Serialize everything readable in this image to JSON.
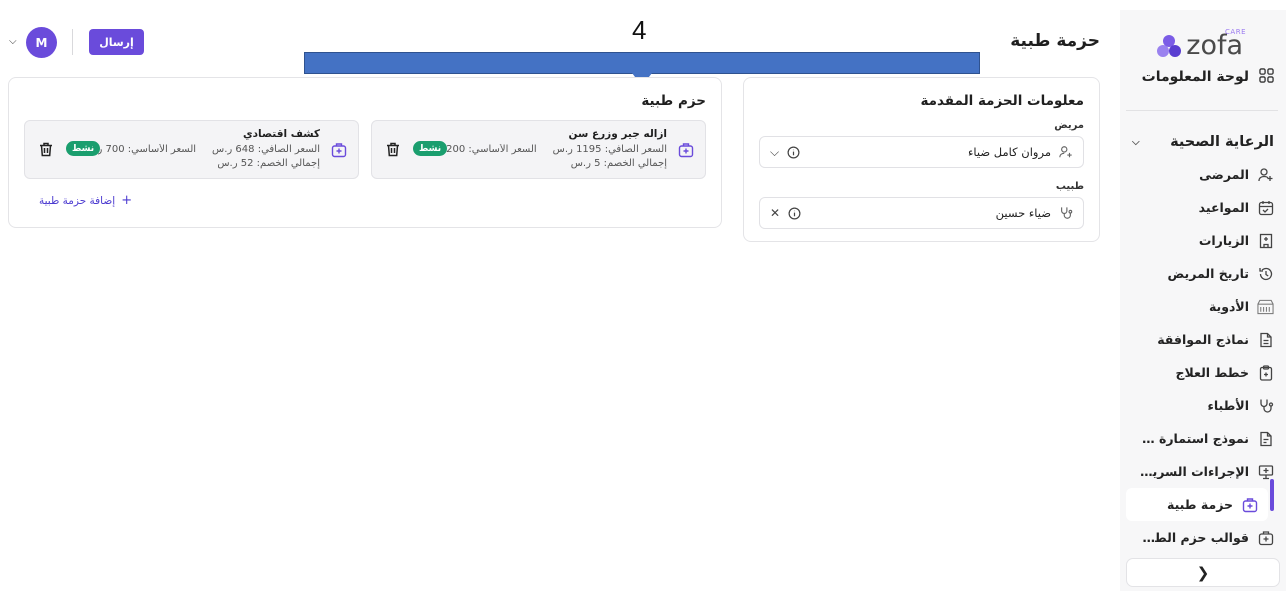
{
  "step_number": "4",
  "overlay_color": "#4472c4",
  "accent_color": "#6a4bdb",
  "active_badge_color": "#1a9e6e",
  "brand": {
    "name": "zofa",
    "tagline": "CARE"
  },
  "sidebar": {
    "dashboard_label": "لوحة المعلومات",
    "section_label": "الرعاية الصحية",
    "items": [
      {
        "label": "المرضى",
        "icon": "patients-icon"
      },
      {
        "label": "المواعيد",
        "icon": "calendar-icon"
      },
      {
        "label": "الزيارات",
        "icon": "building-icon"
      },
      {
        "label": "تاريخ المريض",
        "icon": "history-icon"
      },
      {
        "label": "الأدوية",
        "icon": "pharmacy-icon"
      },
      {
        "label": "نماذج الموافقة",
        "icon": "document-icon"
      },
      {
        "label": "خطط العلاج",
        "icon": "clipboard-icon"
      },
      {
        "label": "الأطباء",
        "icon": "stethoscope-icon"
      },
      {
        "label": "نموذج استمارة الموا...",
        "icon": "form-icon"
      },
      {
        "label": "الإجراءات السريرية",
        "icon": "monitor-icon"
      },
      {
        "label": "حزمة طبية",
        "icon": "medical-kit-icon",
        "active": true
      },
      {
        "label": "قوالب حزم الطبية",
        "icon": "template-kit-icon"
      }
    ],
    "collapse_icon": "chevron-left-icon"
  },
  "header": {
    "title": "حزمة طبية",
    "send_label": "إرسال",
    "avatar_initial": "M"
  },
  "info_card": {
    "title": "معلومات الحزمة المقدمة",
    "patient_label": "مريض",
    "patient_value": "مروان كامل ضياء",
    "doctor_label": "طبيب",
    "doctor_value": "ضياء حسين"
  },
  "packages_card": {
    "title": "حزم طبية",
    "add_label": "إضافة حزمة طبية",
    "packages": [
      {
        "name": "ازاله جير وزرع سن",
        "net_price": "السعر الصافي: 1195 ر.س",
        "base_price": "السعر الأساسي: 1200 ر...",
        "discount": "إجمالي الخصم:  5 ر.س",
        "status": "نشط"
      },
      {
        "name": "كشف اقتصادي",
        "net_price": "السعر الصافي: 648 ر.س",
        "base_price": "السعر الأساسي: 700 ر.س",
        "discount": "إجمالي الخصم:  52 ر.س",
        "status": "نشط"
      }
    ]
  }
}
